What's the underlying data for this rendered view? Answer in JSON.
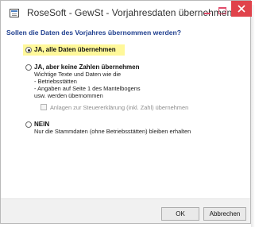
{
  "window": {
    "title": "RoseSoft - GewSt - Vorjahresdaten übernehmen",
    "close_color": "#e0434b"
  },
  "dialog": {
    "question": "Sollen die Daten des Vorjahres übernommen werden?",
    "options": [
      {
        "label": "JA, alle Daten übernehmen",
        "selected": true,
        "highlight_color": "#fff89a"
      },
      {
        "label": "JA, aber keine Zahlen übernehmen",
        "selected": false,
        "description": [
          "Wichtige Texte und Daten wie die",
          "- Betriebsstätten",
          "- Angaben auf Seite 1 des Mantelbogens",
          "usw. werden übernommen"
        ],
        "checkbox": {
          "label": "Anlagen zur Steuererklärung (inkl. Zahl) übernehmen",
          "checked": false,
          "enabled": false
        }
      },
      {
        "label": "NEIN",
        "selected": false,
        "description": [
          "Nur die Stammdaten (ohne Betriebsstätten) bleiben erhalten"
        ]
      }
    ]
  },
  "buttons": {
    "ok": "OK",
    "cancel": "Abbrechen"
  },
  "colors": {
    "question_text": "#1f3f8f",
    "footer_bg": "#f1f1f1"
  }
}
